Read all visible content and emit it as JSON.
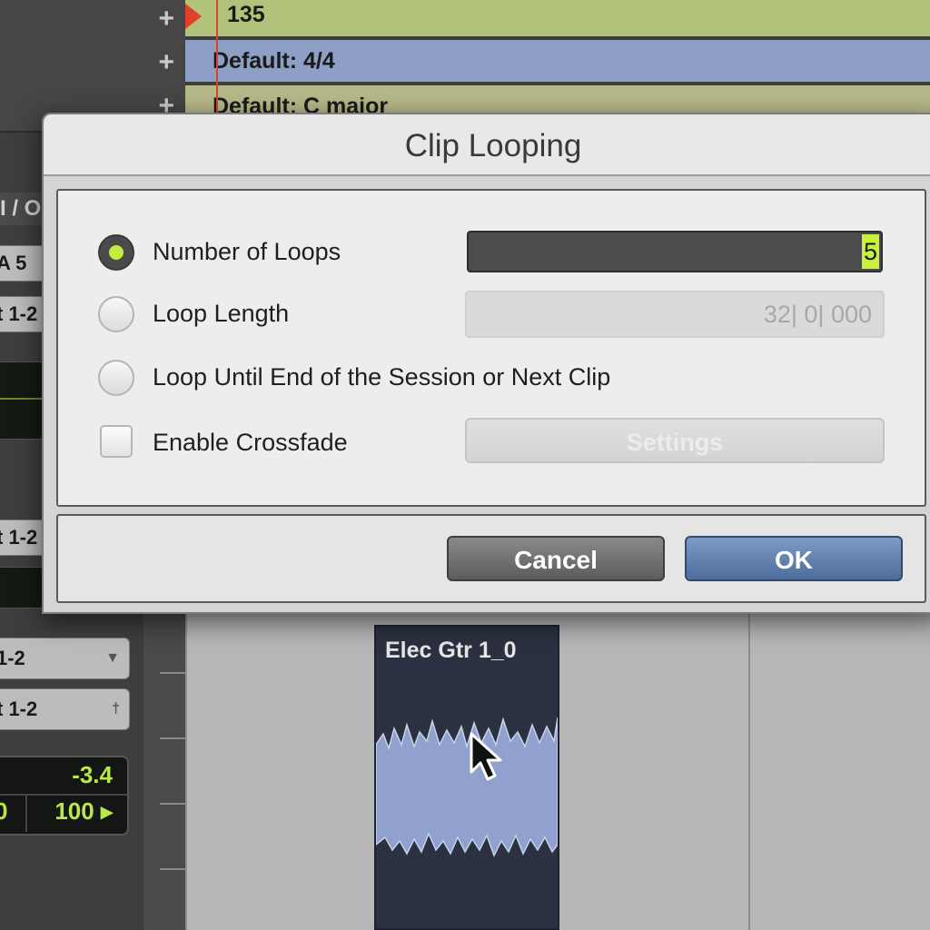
{
  "ruler": {
    "tempo_value": "135",
    "meter_value": "Default: 4/4",
    "key_value": "Default: C major"
  },
  "tracks": {
    "io_header": "I / O",
    "input_a": "A 5",
    "output_1": "t 1-2",
    "output_2": "t 1-2",
    "selector_1": "1-2",
    "selector_2": "t 1-2",
    "volume": "-3.4",
    "pan_left": "0",
    "pan_right": "100 ▸"
  },
  "clip": {
    "name": "Elec Gtr 1_0"
  },
  "dialog": {
    "title": "Clip Looping",
    "options": {
      "number_of_loops": {
        "label": "Number of Loops",
        "value": "5",
        "selected": true
      },
      "loop_length": {
        "label": "Loop Length",
        "value": "32| 0| 000",
        "selected": false
      },
      "loop_until_end": {
        "label": "Loop Until End of the Session or Next Clip",
        "selected": false
      },
      "enable_crossfade": {
        "label": "Enable Crossfade",
        "checked": false,
        "settings_label": "Settings"
      }
    },
    "buttons": {
      "cancel": "Cancel",
      "ok": "OK"
    }
  },
  "colors": {
    "tempo_ruler": "#b3c27a",
    "meter_ruler": "#8d9fc4",
    "key_ruler": "#b8b98a",
    "radio_dot": "#c6ec3f",
    "ok_button": "#5a7aa8",
    "clip_bg": "#2b3140",
    "waveform": "#8fa1cc"
  },
  "icons": {
    "add": "plus-icon",
    "tempo_marker": "triangle-marker-icon",
    "cursor": "arrow-cursor-icon",
    "dropdown": "chevron-down-icon"
  }
}
